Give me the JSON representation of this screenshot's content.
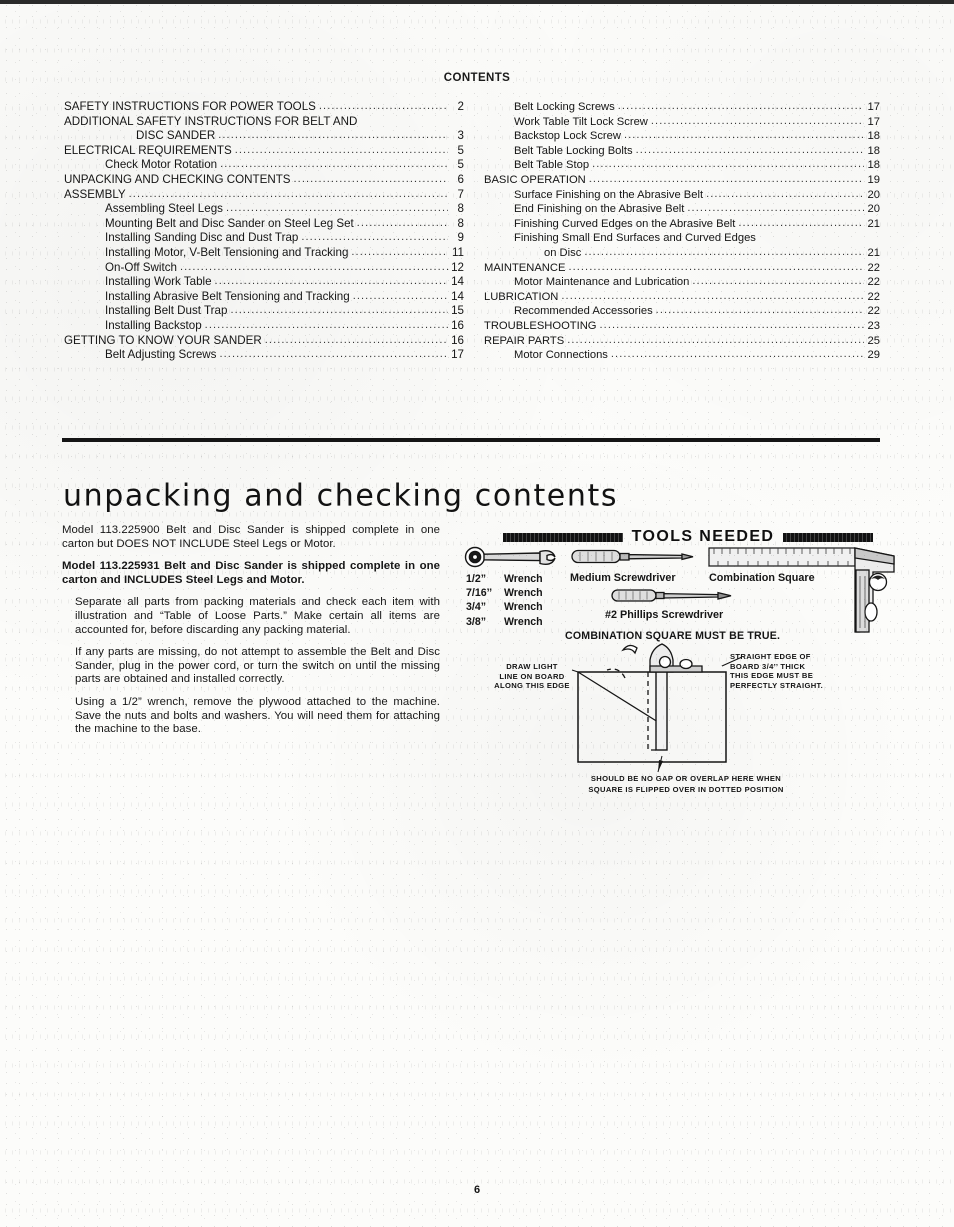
{
  "document": {
    "contents_title": "CONTENTS",
    "page_number": "6"
  },
  "toc": {
    "left": [
      {
        "level": 1,
        "label": "SAFETY INSTRUCTIONS FOR POWER TOOLS",
        "page": "2",
        "dots": true
      },
      {
        "level": 1,
        "label": "ADDITIONAL SAFETY INSTRUCTIONS FOR BELT AND",
        "page": "",
        "dots": false
      },
      {
        "level": 3,
        "label": "DISC SANDER",
        "page": "3",
        "dots": true
      },
      {
        "level": 1,
        "label": "ELECTRICAL REQUIREMENTS",
        "page": "5",
        "dots": true
      },
      {
        "level": 2,
        "label": "Check Motor Rotation",
        "page": "5",
        "dots": true
      },
      {
        "level": 1,
        "label": "UNPACKING AND CHECKING CONTENTS",
        "page": "6",
        "dots": true
      },
      {
        "level": 1,
        "label": "ASSEMBLY",
        "page": "7",
        "dots": true
      },
      {
        "level": 2,
        "label": "Assembling Steel Legs",
        "page": "8",
        "dots": true
      },
      {
        "level": 2,
        "label": "Mounting Belt and Disc Sander on Steel Leg Set",
        "page": "8",
        "dots": true
      },
      {
        "level": 2,
        "label": "Installing Sanding Disc and Dust Trap",
        "page": "9",
        "dots": true
      },
      {
        "level": 2,
        "label": "Installing Motor, V-Belt Tensioning and Tracking",
        "page": "11",
        "dots": true
      },
      {
        "level": 2,
        "label": "On-Off Switch",
        "page": "12",
        "dots": true
      },
      {
        "level": 2,
        "label": "Installing Work Table",
        "page": "14",
        "dots": true
      },
      {
        "level": 2,
        "label": "Installing Abrasive Belt Tensioning and Tracking",
        "page": "14",
        "dots": true
      },
      {
        "level": 2,
        "label": "Installing Belt Dust Trap",
        "page": "15",
        "dots": true
      },
      {
        "level": 2,
        "label": "Installing Backstop",
        "page": "16",
        "dots": true
      },
      {
        "level": 1,
        "label": "GETTING TO KNOW YOUR SANDER",
        "page": "16",
        "dots": true
      },
      {
        "level": 2,
        "label": "Belt Adjusting Screws",
        "page": "17",
        "dots": true
      }
    ],
    "right": [
      {
        "level": 2,
        "label": "Belt Locking Screws",
        "page": "17",
        "dots": true
      },
      {
        "level": 2,
        "label": "Work Table Tilt Lock Screw",
        "page": "17",
        "dots": true
      },
      {
        "level": 2,
        "label": "Backstop Lock Screw",
        "page": "18",
        "dots": true
      },
      {
        "level": 2,
        "label": "Belt Table Locking Bolts",
        "page": "18",
        "dots": true
      },
      {
        "level": 2,
        "label": "Belt Table Stop",
        "page": "18",
        "dots": true
      },
      {
        "level": 1,
        "label": "BASIC OPERATION",
        "page": "19",
        "dots": true
      },
      {
        "level": 2,
        "label": "Surface Finishing on the Abrasive Belt",
        "page": "20",
        "dots": true
      },
      {
        "level": 2,
        "label": "End Finishing on the Abrasive Belt",
        "page": "20",
        "dots": true
      },
      {
        "level": 2,
        "label": "Finishing Curved Edges on the Abrasive Belt",
        "page": "21",
        "dots": true
      },
      {
        "level": 2,
        "label": "Finishing Small End Surfaces and Curved Edges",
        "page": "",
        "dots": false
      },
      {
        "level": 3,
        "label": "on Disc",
        "page": "21",
        "dots": true
      },
      {
        "level": 1,
        "label": "MAINTENANCE",
        "page": "22",
        "dots": true
      },
      {
        "level": 2,
        "label": "Motor Maintenance and Lubrication",
        "page": "22",
        "dots": true
      },
      {
        "level": 1,
        "label": "LUBRICATION",
        "page": "22",
        "dots": true
      },
      {
        "level": 2,
        "label": "Recommended Accessories",
        "page": "22",
        "dots": true
      },
      {
        "level": 1,
        "label": "TROUBLESHOOTING",
        "page": "23",
        "dots": true
      },
      {
        "level": 1,
        "label": "REPAIR PARTS",
        "page": "25",
        "dots": true
      },
      {
        "level": 2,
        "label": "Motor Connections",
        "page": "29",
        "dots": true
      }
    ]
  },
  "section": {
    "heading": "unpacking and checking contents",
    "paragraphs": [
      {
        "style": "plain",
        "text": "Model 113.225900 Belt and Disc Sander is shipped complete in one carton but DOES NOT INCLUDE Steel Legs or Motor."
      },
      {
        "style": "bold",
        "text": "Model 113.225931 Belt and Disc Sander is shipped complete in one carton and INCLUDES Steel Legs and Motor."
      },
      {
        "style": "indent",
        "text": "Separate all parts from packing materials and check each item with illustration and “Table of Loose Parts.” Make certain all items are accounted for, before discarding any packing material."
      },
      {
        "style": "indent",
        "text": "If any parts are missing, do not attempt to assemble the Belt and Disc Sander, plug in the power cord, or turn the switch on until the missing parts are obtained and installed correctly."
      },
      {
        "style": "indent",
        "text": "Using a 1/2” wrench, remove the plywood attached to the machine. Save the nuts and bolts and washers. You will need them for attaching the machine to the base."
      }
    ]
  },
  "tools": {
    "banner_title": "TOOLS NEEDED",
    "wrenches": [
      {
        "size": "1/2”",
        "name": "Wrench"
      },
      {
        "size": "7/16’’",
        "name": "Wrench"
      },
      {
        "size": "3/4”",
        "name": "Wrench"
      },
      {
        "size": "3/8”",
        "name": "Wrench"
      }
    ],
    "captions": {
      "medium_screwdriver": "Medium Screwdriver",
      "combination_square": "Combination Square",
      "phillips_screwdriver": "#2 Phillips Screwdriver",
      "square_must_be_true": "COMBINATION SQUARE MUST BE TRUE."
    }
  },
  "square_diagram": {
    "note_left": "DRAW LIGHT\nLINE ON BOARD\nALONG THIS EDGE",
    "note_right": "STRAIGHT EDGE OF\nBOARD 3/4’’ THICK\nTHIS EDGE MUST BE\nPERFECTLY STRAIGHT.",
    "note_bottom": "SHOULD BE NO GAP OR OVERLAP HERE WHEN\nSQUARE IS FLIPPED OVER IN DOTTED POSITION"
  },
  "colors": {
    "ink": "#141414",
    "paper": "#fcfcfa"
  }
}
